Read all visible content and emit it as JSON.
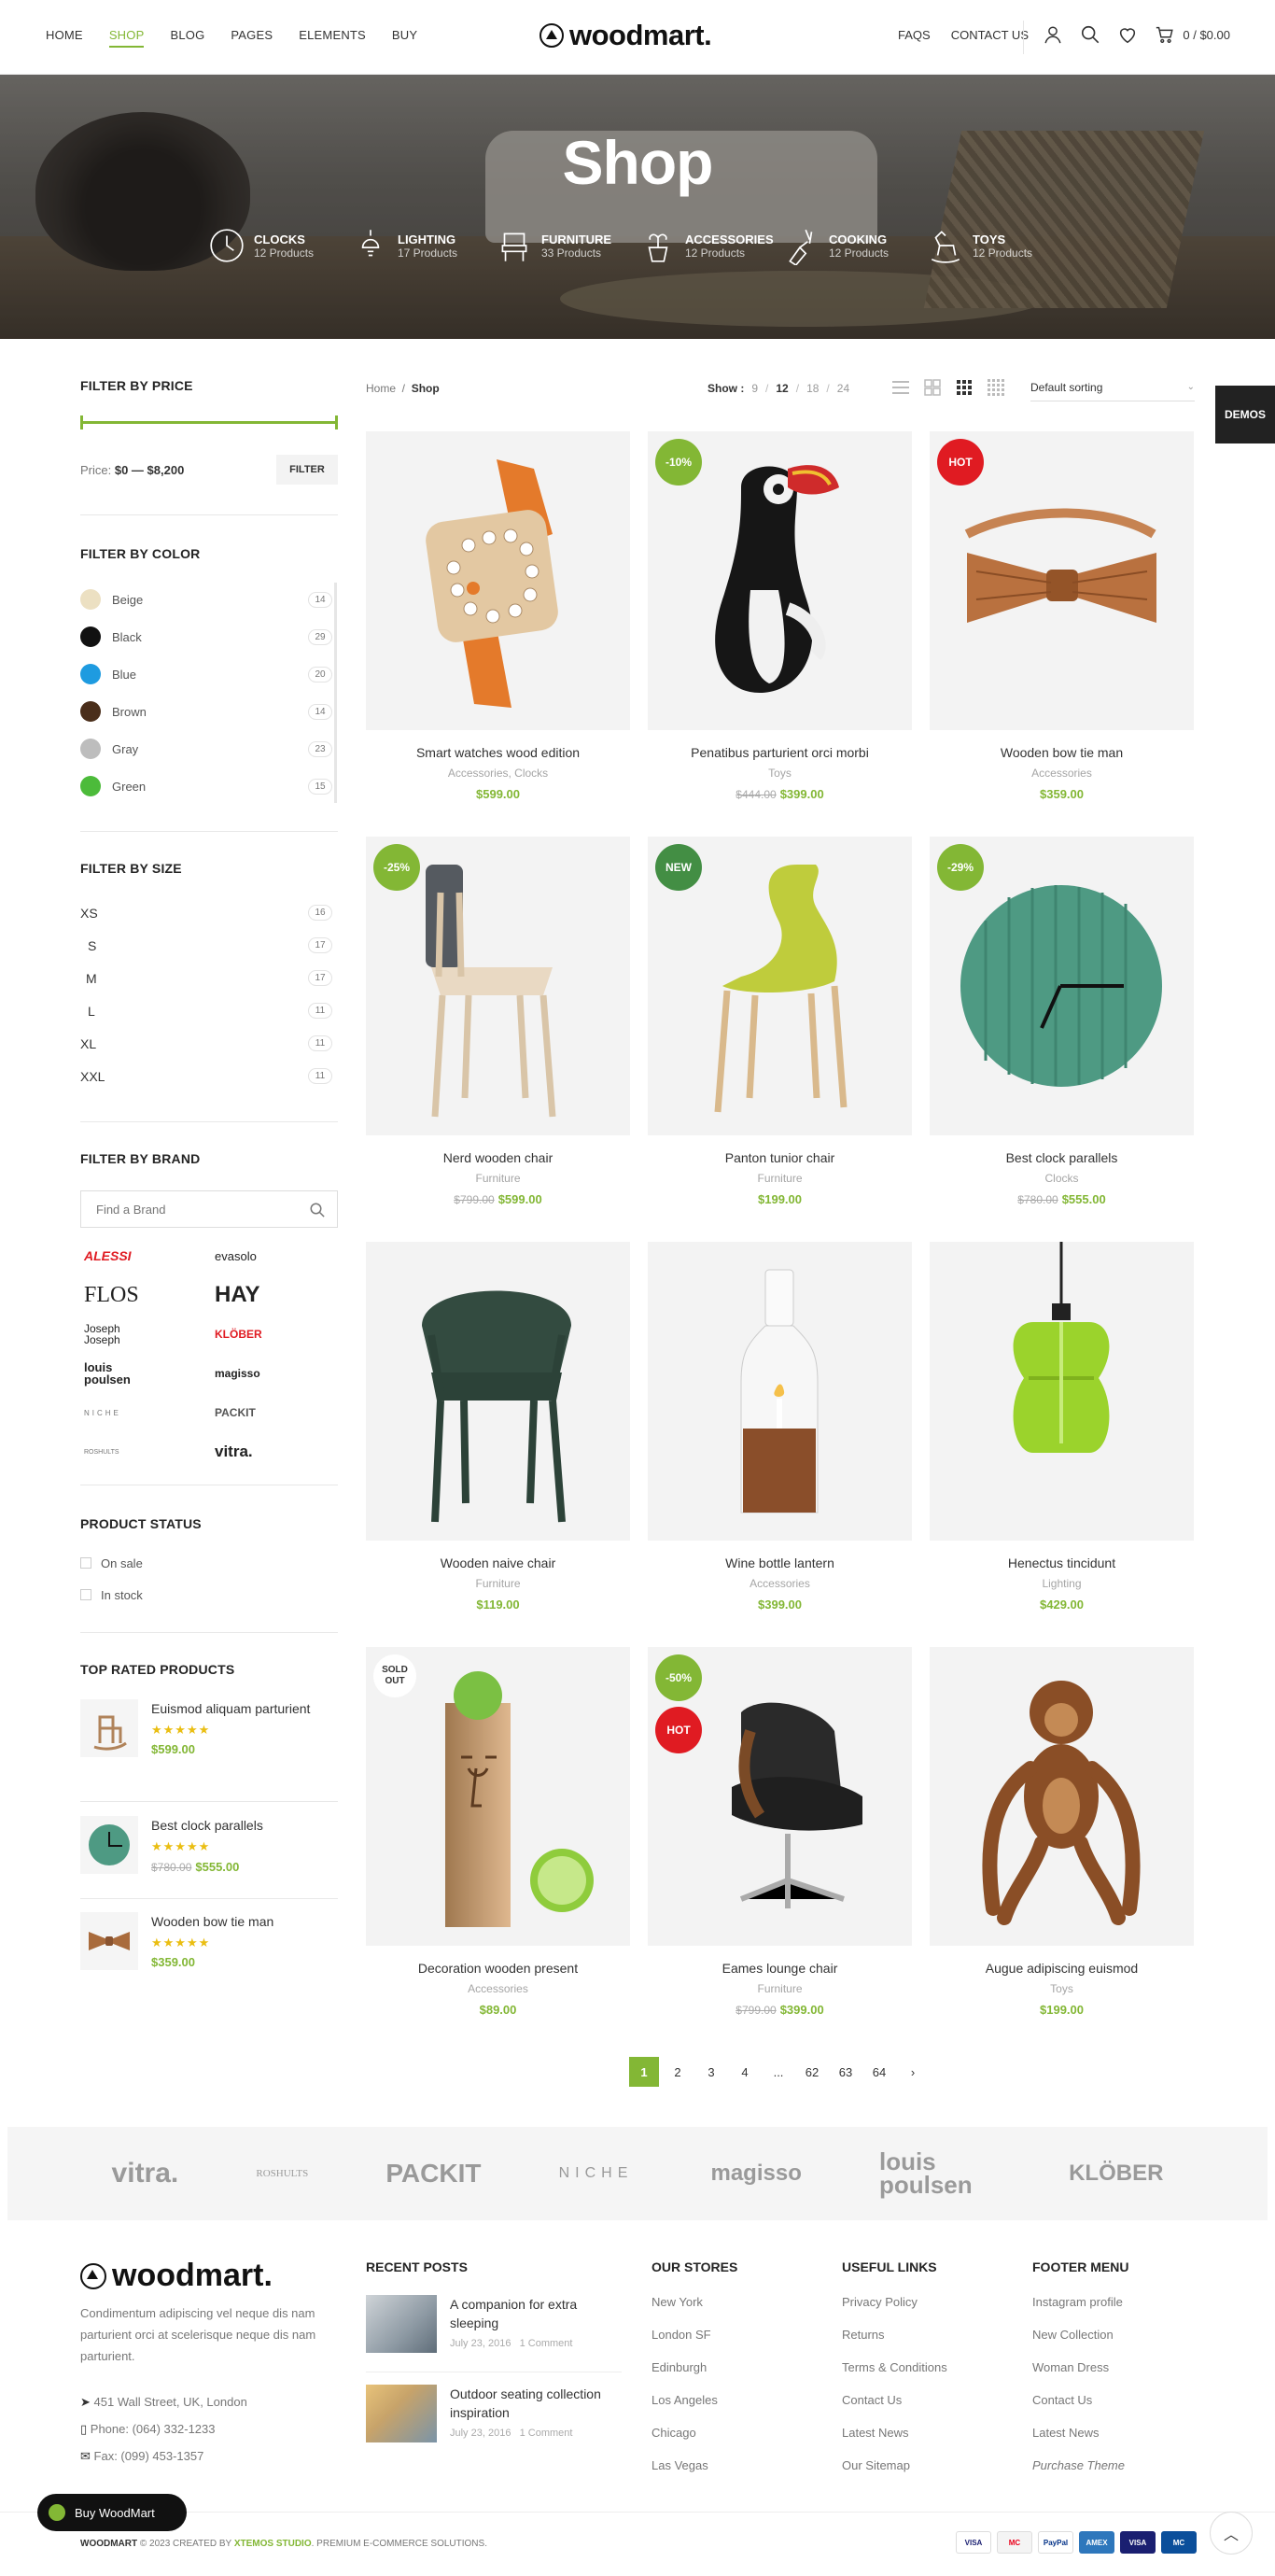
{
  "header": {
    "nav": [
      "HOME",
      "SHOP",
      "BLOG",
      "PAGES",
      "ELEMENTS",
      "BUY"
    ],
    "active_nav": "SHOP",
    "logo": "woodmart.",
    "right_nav": [
      "FAQS",
      "CONTACT US"
    ],
    "cart_total": "0 / $0.00"
  },
  "hero": {
    "title": "Shop",
    "categories": [
      {
        "name": "CLOCKS",
        "count": "12 Products",
        "icon": "clock-icon"
      },
      {
        "name": "LIGHTING",
        "count": "17 Products",
        "icon": "lamp-icon"
      },
      {
        "name": "FURNITURE",
        "count": "33 Products",
        "icon": "chair-icon"
      },
      {
        "name": "ACCESSORIES",
        "count": "12 Products",
        "icon": "vase-icon"
      },
      {
        "name": "COOKING",
        "count": "12 Products",
        "icon": "kitchen-icon"
      },
      {
        "name": "TOYS",
        "count": "12 Products",
        "icon": "rocking-horse-icon"
      }
    ]
  },
  "sidebar": {
    "price_title": "FILTER BY PRICE",
    "price_label": "Price:",
    "price_range": "$0 — $8,200",
    "filter_button": "FILTER",
    "color_title": "FILTER BY COLOR",
    "colors": [
      {
        "name": "Beige",
        "count": "14",
        "hex": "#ece0c2"
      },
      {
        "name": "Black",
        "count": "29",
        "hex": "#111111"
      },
      {
        "name": "Blue",
        "count": "20",
        "hex": "#1e9be0"
      },
      {
        "name": "Brown",
        "count": "14",
        "hex": "#4a2e1a"
      },
      {
        "name": "Gray",
        "count": "23",
        "hex": "#bdbdbd"
      },
      {
        "name": "Green",
        "count": "15",
        "hex": "#4cbb3a"
      }
    ],
    "size_title": "FILTER BY SIZE",
    "sizes": [
      {
        "name": "XS",
        "count": "16"
      },
      {
        "name": "S",
        "count": "17"
      },
      {
        "name": "M",
        "count": "17"
      },
      {
        "name": "L",
        "count": "11"
      },
      {
        "name": "XL",
        "count": "11"
      },
      {
        "name": "XXL",
        "count": "11"
      }
    ],
    "brand_title": "FILTER BY BRAND",
    "brand_placeholder": "Find a Brand",
    "brands": [
      "ALESSI",
      "evasolo",
      "FLOS",
      "HAY",
      "Joseph Joseph",
      "KLÖBER",
      "louis poulsen",
      "magisso",
      "NICHE",
      "PACKIT",
      "ROSHULTS",
      "vitra."
    ],
    "status_title": "PRODUCT STATUS",
    "status": [
      "On sale",
      "In stock"
    ],
    "top_title": "TOP RATED PRODUCTS",
    "top_rated": [
      {
        "name": "Euismod aliquam parturient",
        "old": "",
        "price": "$599.00"
      },
      {
        "name": "Best clock parallels",
        "old": "$780.00",
        "price": "$555.00"
      },
      {
        "name": "Wooden bow tie man",
        "old": "",
        "price": "$359.00"
      }
    ]
  },
  "toolbar": {
    "home": "Home",
    "current": "Shop",
    "show_label": "Show :",
    "show_options": [
      "9",
      "12",
      "18",
      "24"
    ],
    "show_selected": "12",
    "sorting": "Default sorting"
  },
  "products": [
    {
      "name": "Smart watches wood edition",
      "cat": "Accessories, Clocks",
      "old": "",
      "price": "$599.00",
      "labels": []
    },
    {
      "name": "Penatibus parturient orci morbi",
      "cat": "Toys",
      "old": "$444.00",
      "price": "$399.00",
      "labels": [
        {
          "text": "-10%",
          "kind": "green"
        }
      ]
    },
    {
      "name": "Wooden bow tie man",
      "cat": "Accessories",
      "old": "",
      "price": "$359.00",
      "labels": [
        {
          "text": "HOT",
          "kind": "red"
        }
      ]
    },
    {
      "name": "Nerd wooden chair",
      "cat": "Furniture",
      "old": "$799.00",
      "price": "$599.00",
      "labels": [
        {
          "text": "-25%",
          "kind": "green"
        }
      ]
    },
    {
      "name": "Panton tunior chair",
      "cat": "Furniture",
      "old": "",
      "price": "$199.00",
      "labels": [
        {
          "text": "NEW",
          "kind": "dgreen"
        }
      ]
    },
    {
      "name": "Best clock parallels",
      "cat": "Clocks",
      "old": "$780.00",
      "price": "$555.00",
      "labels": [
        {
          "text": "-29%",
          "kind": "green"
        }
      ]
    },
    {
      "name": "Wooden naive chair",
      "cat": "Furniture",
      "old": "",
      "price": "$119.00",
      "labels": []
    },
    {
      "name": "Wine bottle lantern",
      "cat": "Accessories",
      "old": "",
      "price": "$399.00",
      "labels": []
    },
    {
      "name": "Henectus tincidunt",
      "cat": "Lighting",
      "old": "",
      "price": "$429.00",
      "labels": []
    },
    {
      "name": "Decoration wooden present",
      "cat": "Accessories",
      "old": "",
      "price": "$89.00",
      "labels": [
        {
          "text": "SOLD OUT",
          "kind": "sold"
        }
      ]
    },
    {
      "name": "Eames lounge chair",
      "cat": "Furniture",
      "old": "$799.00",
      "price": "$399.00",
      "labels": [
        {
          "text": "-50%",
          "kind": "green"
        },
        {
          "text": "HOT",
          "kind": "red"
        }
      ]
    },
    {
      "name": "Augue adipiscing euismod",
      "cat": "Toys",
      "old": "",
      "price": "$199.00",
      "labels": []
    }
  ],
  "pagination": {
    "pages": [
      "1",
      "2",
      "3",
      "4",
      "...",
      "62",
      "63",
      "64"
    ],
    "current": "1",
    "next": "›"
  },
  "brand_strip": [
    "vitra.",
    "ROSHULTS",
    "PACKIT",
    "NICHE",
    "magisso",
    "louis poulsen",
    "KLÖBER"
  ],
  "footer": {
    "logo": "woodmart.",
    "about": "Condimentum adipiscing vel neque dis nam parturient orci at scelerisque neque dis nam parturient.",
    "address": "451 Wall Street, UK, London",
    "phone": "Phone: (064) 332-1233",
    "fax": "Fax: (099) 453-1357",
    "recent_title": "RECENT POSTS",
    "posts": [
      {
        "title": "A companion for extra sleeping",
        "date": "July 23, 2016",
        "comments": "1 Comment"
      },
      {
        "title": "Outdoor seating collection inspiration",
        "date": "July 23, 2016",
        "comments": "1 Comment"
      }
    ],
    "stores_title": "OUR STORES",
    "stores": [
      "New York",
      "London SF",
      "Edinburgh",
      "Los Angeles",
      "Chicago",
      "Las Vegas"
    ],
    "useful_title": "USEFUL LINKS",
    "useful": [
      "Privacy Policy",
      "Returns",
      "Terms & Conditions",
      "Contact Us",
      "Latest News",
      "Our Sitemap"
    ],
    "menu_title": "FOOTER MENU",
    "menu": [
      "Instagram profile",
      "New Collection",
      "Woman Dress",
      "Contact Us",
      "Latest News",
      "Purchase Theme"
    ],
    "copyright_brand": "WOODMART",
    "copyright_rest": "© 2023 CREATED BY",
    "copyright_studio": "XTEMOS STUDIO",
    "copyright_tail": ". PREMIUM E-COMMERCE SOLUTIONS.",
    "payments": [
      "VISA",
      "MC",
      "PayPal",
      "AMEX",
      "VISA",
      "MC"
    ],
    "buy_button": "Buy WoodMart"
  },
  "demos": "DEMOS",
  "colors": {
    "accent": "#83b735",
    "hot": "#e01b22",
    "new": "#438e44"
  }
}
